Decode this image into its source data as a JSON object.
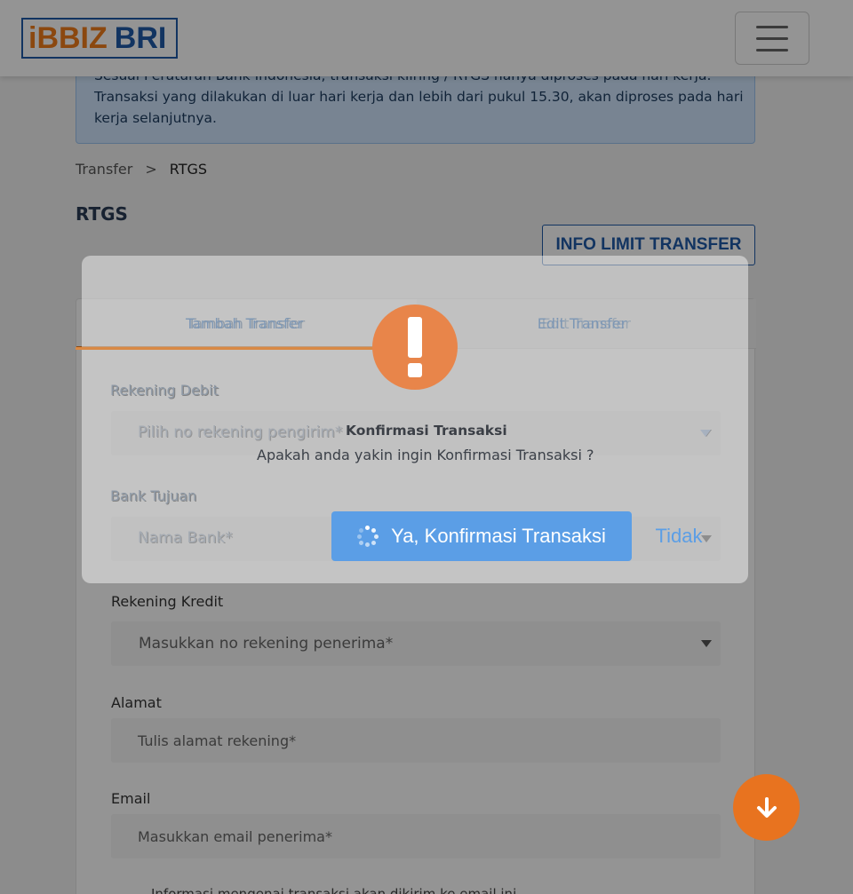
{
  "header": {
    "logo_part1": "iBBIZ",
    "logo_part2": "BRI",
    "menu_icon": "hamburger-icon"
  },
  "alert": {
    "line1": "Sesuai Peraturan Bank Indonesia, transaksi kliring / RTGS hanya diproses pada hari kerja.",
    "line2": "Transaksi yang dilakukan di luar hari kerja dan lebih dari pukul 15.30, akan diproses pada hari",
    "line3": "kerja selanjutnya."
  },
  "breadcrumb": {
    "parent": "Transfer",
    "separator": ">",
    "current": "RTGS"
  },
  "page_title": "RTGS",
  "info_limit_button": "INFO LIMIT TRANSFER",
  "tabs": [
    {
      "label": "Tambah Transfer"
    },
    {
      "label": "Edit Transfer"
    }
  ],
  "form": {
    "rekening_debit_label": "Rekening Debit",
    "rekening_debit_placeholder": "Pilih no rekening pengirim*",
    "bank_tujuan_label": "Bank Tujuan",
    "bank_tujuan_placeholder": "Nama Bank*",
    "rekening_kredit_label": "Rekening Kredit",
    "rekening_kredit_placeholder": "Masukkan no rekening penerima*",
    "alamat_label": "Alamat",
    "alamat_placeholder": "Tulis alamat rekening*",
    "email_label": "Email",
    "email_placeholder": "Masukkan email penerima*",
    "email_note": "Informasi mengenai transaksi akan dikirim ke email ini"
  },
  "modal": {
    "icon": "exclamation-icon",
    "title": "Konfirmasi Transaksi",
    "message": "Apakah anda yakin ingin Konfirmasi Transaksi ?",
    "confirm_button": "Ya, Konfirmasi Transaksi",
    "cancel_button": "Tidak"
  },
  "fab_icon": "arrow-down-icon",
  "colors": {
    "brand_orange": "#f07c1b",
    "brand_blue": "#1f5aa8",
    "confirm_blue": "#5b9ee6",
    "warning_orange": "#e8854a"
  }
}
